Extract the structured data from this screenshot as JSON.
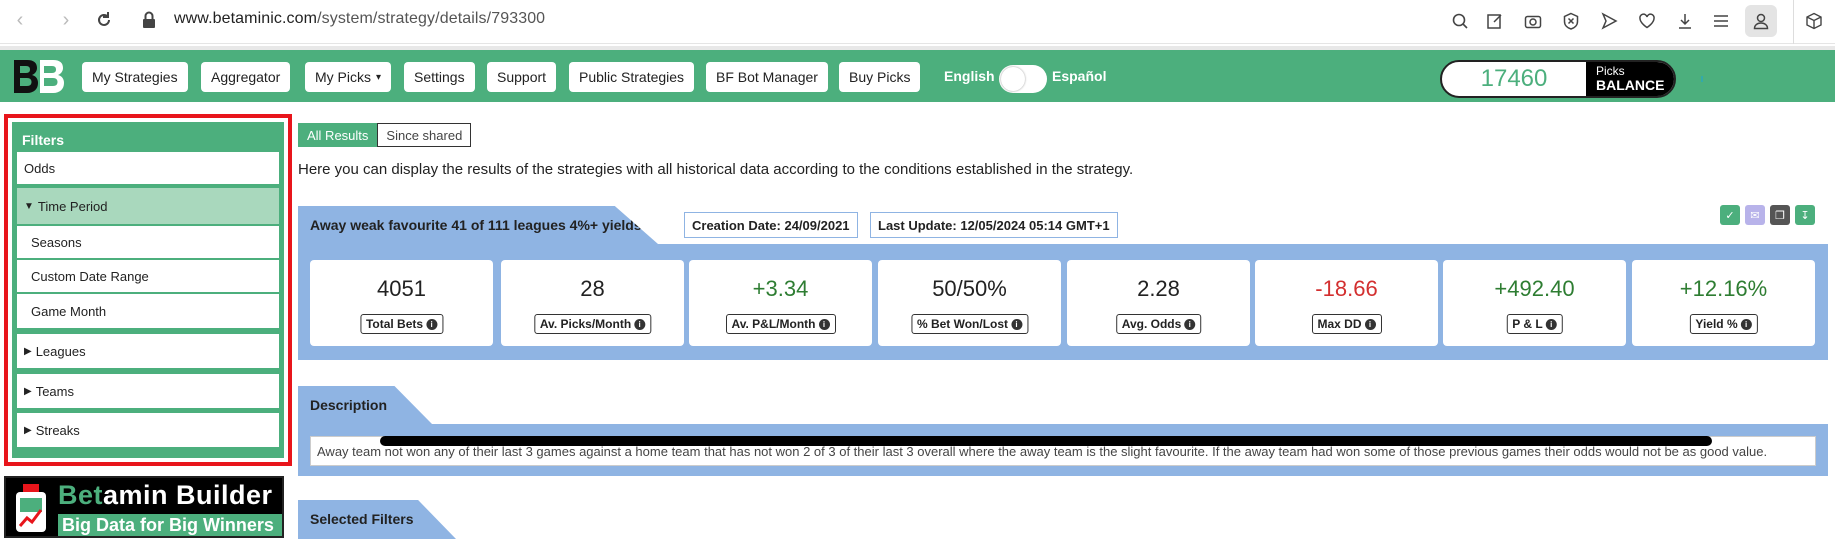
{
  "browser": {
    "url_host": "www.betaminic.com",
    "url_path": "/system/strategy/details/793300"
  },
  "nav": {
    "items": [
      "My Strategies",
      "Aggregator",
      "My Picks",
      "Settings",
      "Support",
      "Public Strategies",
      "BF Bot Manager",
      "Buy Picks"
    ],
    "my_picks_caret": "▾",
    "lang_left": "English",
    "lang_right": "Español",
    "balance_value": "17460",
    "balance_label1": "Picks",
    "balance_label2": "BALANCE",
    "accent": "#4caf7d"
  },
  "sidebar": {
    "header": "Filters",
    "items": [
      {
        "label": "Odds"
      },
      {
        "label": "Time Period"
      },
      {
        "label": "Seasons"
      },
      {
        "label": "Custom Date Range"
      },
      {
        "label": "Game Month"
      },
      {
        "label": "Leagues"
      },
      {
        "label": "Teams"
      },
      {
        "label": "Streaks"
      }
    ],
    "logo_text_green": "Bet",
    "logo_text_white": "amin Builder",
    "logo_tagline": "Big Data for Big Winners"
  },
  "main": {
    "tabs": [
      "All Results",
      "Since shared"
    ],
    "intro": "Here you can display the results of the strategies with all historical data according to the conditions established in the strategy.",
    "strategy_name": "Away weak favourite 41 of 111 leagues 4%+ yields",
    "creation_date": "Creation Date: 24/09/2021",
    "last_update": "Last Update: 12/05/2024 05:14 GMT+1",
    "stats": [
      {
        "value": "4051",
        "label": "Total Bets",
        "tone": "neutral"
      },
      {
        "value": "28",
        "label": "Av. Picks/Month",
        "tone": "neutral"
      },
      {
        "value": "+3.34",
        "label": "Av. P&L/Month",
        "tone": "pos"
      },
      {
        "value": "50/50%",
        "label": "% Bet Won/Lost",
        "tone": "neutral"
      },
      {
        "value": "2.28",
        "label": "Avg. Odds",
        "tone": "neutral"
      },
      {
        "value": "-18.66",
        "label": "Max DD",
        "tone": "neg"
      },
      {
        "value": "+492.40",
        "label": "P & L",
        "tone": "pos"
      },
      {
        "value": "+12.16%",
        "label": "Yield %",
        "tone": "pos"
      }
    ],
    "description_head": "Description",
    "description_text": "Away team not won any of their last 3 games against a home team that has not won 2 of 3 of their last 3 overall where the away team is the slight favourite. If the away team had won some of those previous games their odds would not be as good value.",
    "selected_filters_head": "Selected Filters"
  }
}
